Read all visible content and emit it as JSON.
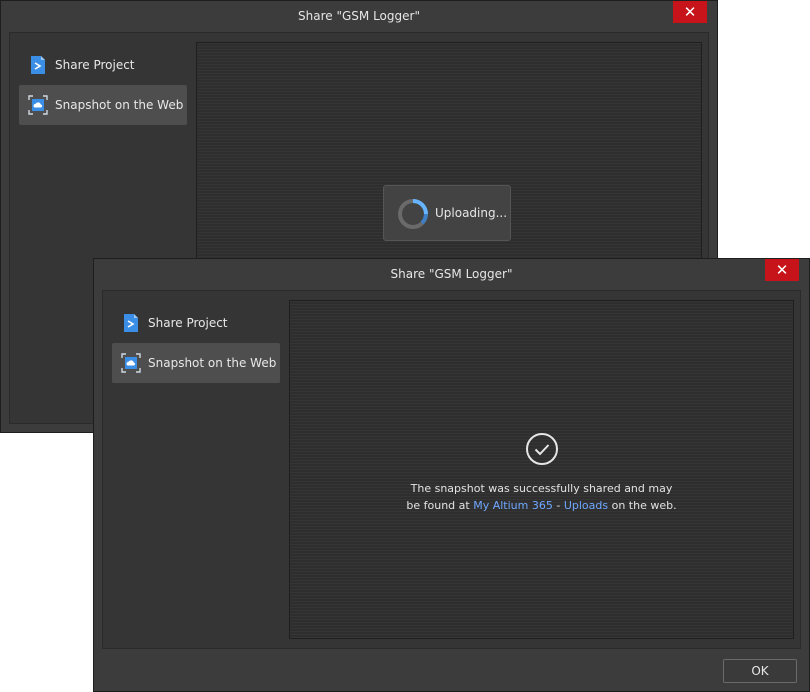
{
  "back_window": {
    "title": "Share \"GSM Logger\"",
    "close_glyph": "✕",
    "nav": [
      {
        "label": "Share Project",
        "icon": "share-project-icon"
      },
      {
        "label": "Snapshot on the Web",
        "icon": "snapshot-web-icon",
        "active": true
      }
    ],
    "status": "Uploading..."
  },
  "front_window": {
    "title": "Share \"GSM Logger\"",
    "close_glyph": "✕",
    "nav": [
      {
        "label": "Share Project",
        "icon": "share-project-icon"
      },
      {
        "label": "Snapshot on the Web",
        "icon": "snapshot-web-icon",
        "active": true
      }
    ],
    "success": {
      "line1": "The snapshot was successfully shared and may",
      "line2_prefix": "be found at ",
      "link1": "My Altium 365",
      "separator": " - ",
      "link2": "Uploads",
      "line2_suffix": " on the web."
    },
    "ok_label": "OK"
  },
  "colors": {
    "accent_link": "#6fa8ff",
    "close_button": "#c7141a",
    "window_bg": "#3c3c3c"
  }
}
